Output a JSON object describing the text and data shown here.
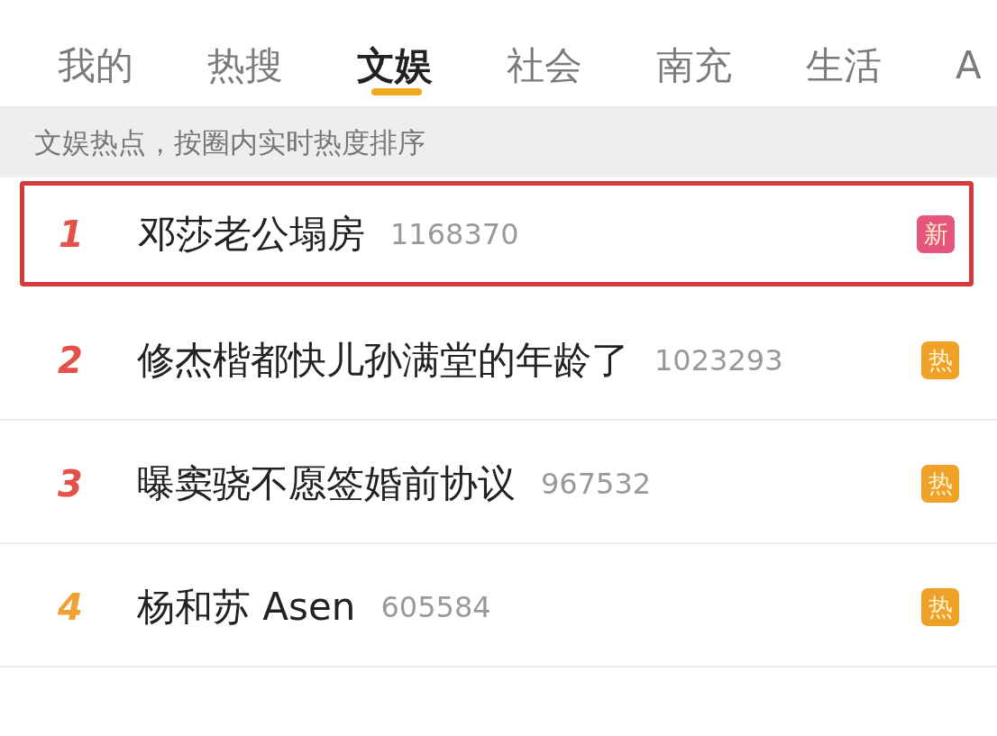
{
  "tabs": [
    {
      "label": "我的",
      "selected": false
    },
    {
      "label": "热搜",
      "selected": false
    },
    {
      "label": "文娱",
      "selected": true
    },
    {
      "label": "社会",
      "selected": false
    },
    {
      "label": "南充",
      "selected": false
    },
    {
      "label": "生活",
      "selected": false
    },
    {
      "label": "A",
      "selected": false
    }
  ],
  "notice": "文娱热点，按圈内实时热度排序",
  "items": [
    {
      "rank": "1",
      "color": "#e4514a",
      "title": "邓莎老公塌房",
      "count": "1168370",
      "badge": "新",
      "kind": "new",
      "highlighted": true
    },
    {
      "rank": "2",
      "color": "#e4514a",
      "title": "修杰楷都快儿孙满堂的年龄了",
      "count": "1023293",
      "badge": "热",
      "kind": "hot",
      "highlighted": false
    },
    {
      "rank": "3",
      "color": "#e4514a",
      "title": "曝窦骁不愿签婚前协议",
      "count": "967532",
      "badge": "热",
      "kind": "hot",
      "highlighted": false
    },
    {
      "rank": "4",
      "color": "#eea236",
      "title": "杨和苏 Asen",
      "count": "605584",
      "badge": "热",
      "kind": "hot",
      "highlighted": false
    }
  ]
}
